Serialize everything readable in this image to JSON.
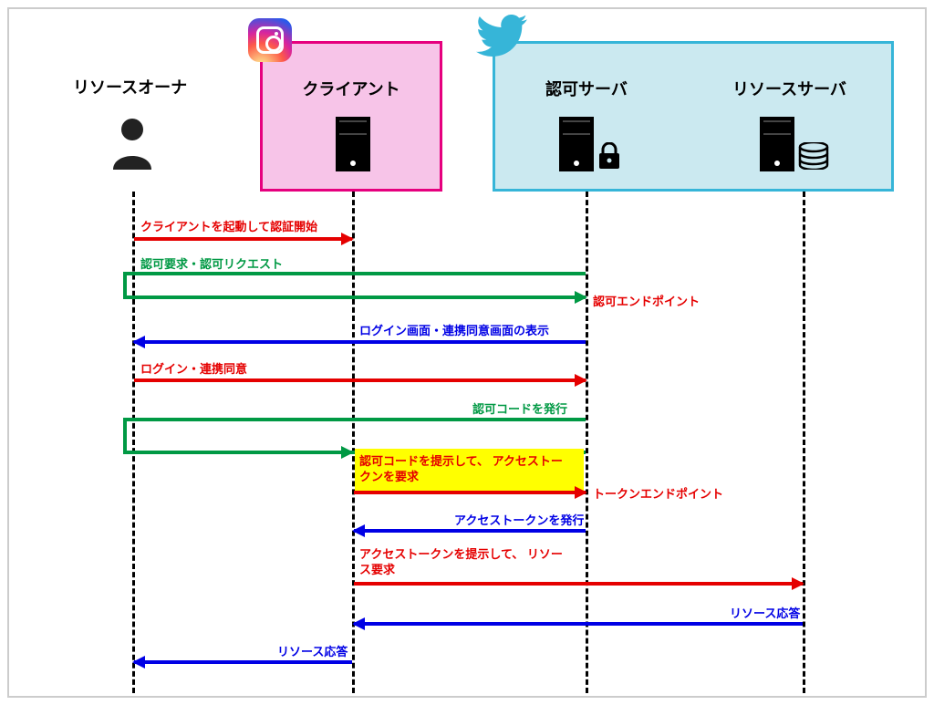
{
  "actors": {
    "resource_owner": "リソースオーナ",
    "client": "クライアント",
    "auth_server": "認可サーバ",
    "resource_server": "リソースサーバ"
  },
  "messages": {
    "m1": "クライアントを起動して認証開始",
    "m2": "認可要求・認可リクエスト",
    "m3_right": "認可エンドポイント",
    "m4": "ログイン画面・連携同意画面の表示",
    "m5": "ログイン・連携同意",
    "m6": "認可コードを発行",
    "m7": "認可コードを提示して、\nアクセストークンを要求",
    "m7_right": "トークンエンドポイント",
    "m8": "アクセストークンを発行",
    "m9": "アクセストークンを提示して、\nリソース要求",
    "m10": "リソース応答",
    "m11": "リソース応答"
  },
  "lifelines_x": {
    "owner": 135,
    "client": 376,
    "auth": 632,
    "resource": 870
  },
  "colors": {
    "red": "#e50000",
    "green": "#009944",
    "blue": "#0000e5",
    "highlight": "#ffff00"
  }
}
